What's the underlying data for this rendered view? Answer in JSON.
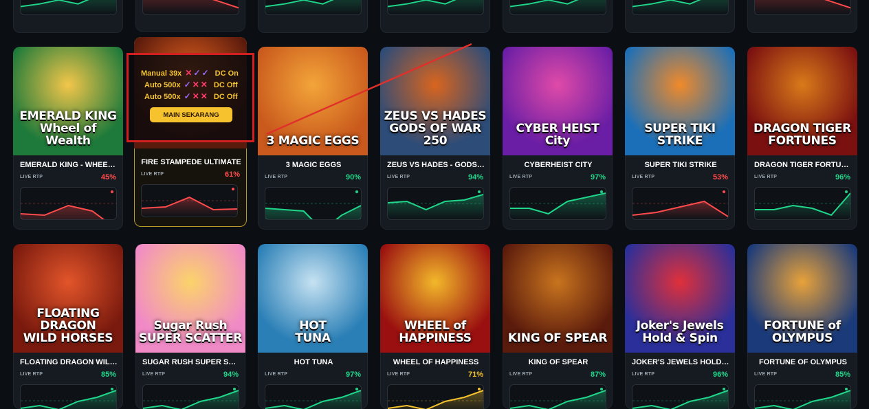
{
  "common": {
    "live_rtp_label": "LIVE RTP"
  },
  "overlay": {
    "rows": [
      {
        "mode": "Manual 39x",
        "marks": [
          "x",
          "c",
          "c"
        ],
        "dc": "DC On"
      },
      {
        "mode": "Auto 500x",
        "marks": [
          "c",
          "x",
          "x"
        ],
        "dc": "DC Off"
      },
      {
        "mode": "Auto 500x",
        "marks": [
          "c",
          "x",
          "x"
        ],
        "dc": "DC Off"
      }
    ],
    "button_label": "MAIN SEKARANG"
  },
  "colors": {
    "up": "#1fd68a",
    "down": "#ff4b4b",
    "accent": "#f6c22d",
    "highlight_border": "#d21f1f"
  },
  "top_row": [
    {
      "trend": "up"
    },
    {
      "trend": "down"
    },
    {
      "trend": "up"
    },
    {
      "trend": "up"
    },
    {
      "trend": "up"
    },
    {
      "trend": "up"
    },
    {
      "trend": "down"
    }
  ],
  "row1": [
    {
      "art": "EMERALD KING\nWheel of Wealth",
      "name": "EMERALD KING - WHEEL ...",
      "rtp": "45%",
      "trend": "down",
      "points": [
        38,
        40,
        26,
        34,
        60
      ]
    },
    {
      "art": "",
      "name": "FIRE STAMPEDE ULTIMATE",
      "rtp": "61%",
      "trend": "down",
      "points": [
        34,
        32,
        18,
        36,
        35
      ],
      "featured": true
    },
    {
      "art": "3 MAGIC EGGS",
      "name": "3 MAGIC EGGS",
      "rtp": "90%",
      "trend": "up",
      "points": [
        30,
        32,
        34,
        62,
        40,
        26
      ]
    },
    {
      "art": "ZEUS VS HADES\nGODS OF WAR 250",
      "name": "ZEUS VS HADES - GODS ...",
      "rtp": "94%",
      "trend": "up",
      "points": [
        22,
        20,
        32,
        20,
        18,
        10
      ]
    },
    {
      "art": "CYBER HEIST\nCity",
      "name": "CYBERHEIST CITY",
      "rtp": "97%",
      "trend": "up",
      "points": [
        30,
        30,
        38,
        20,
        14,
        8
      ]
    },
    {
      "art": "SUPER TIKI\nSTRIKE",
      "name": "SUPER TIKI STRIKE",
      "rtp": "53%",
      "trend": "down",
      "points": [
        40,
        36,
        28,
        20,
        42
      ]
    },
    {
      "art": "DRAGON TIGER\nFORTUNES",
      "name": "DRAGON TIGER FORTUNES",
      "rtp": "96%",
      "trend": "up",
      "points": [
        32,
        32,
        26,
        30,
        40,
        8
      ]
    }
  ],
  "row2": [
    {
      "art": "FLOATING DRAGON\nWILD HORSES",
      "name": "FLOATING DRAGON WILD...",
      "rtp": "85%",
      "trend": "up"
    },
    {
      "art": "Sugar Rush\nSUPER SCATTER",
      "name": "SUGAR RUSH SUPER SCA...",
      "rtp": "94%",
      "trend": "up"
    },
    {
      "art": "HOT\nTUNA",
      "name": "HOT TUNA",
      "rtp": "97%",
      "trend": "up"
    },
    {
      "art": "WHEEL of\nHAPPINESS",
      "name": "WHEEL OF HAPPINESS",
      "rtp": "71%",
      "trend": "neutral"
    },
    {
      "art": "KING OF SPEAR",
      "name": "KING OF SPEAR",
      "rtp": "87%",
      "trend": "up"
    },
    {
      "art": "Joker's Jewels\nHold & Spin",
      "name": "JOKER'S JEWELS HOLD ...",
      "rtp": "96%",
      "trend": "up"
    },
    {
      "art": "FORTUNE of\nOLYMPUS",
      "name": "FORTUNE OF OLYMPUS",
      "rtp": "85%",
      "trend": "up"
    }
  ]
}
